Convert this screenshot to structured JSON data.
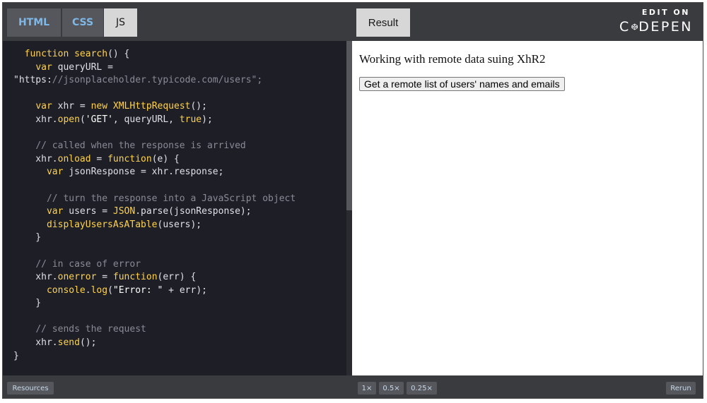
{
  "editor": {
    "tabs": {
      "html": "HTML",
      "css": "CSS",
      "js": "JS"
    }
  },
  "result_panel": {
    "tab_label": "Result",
    "logo": {
      "top": "EDIT ON",
      "left_text": "C",
      "right_text": "DEPEN"
    },
    "heading": "Working with remote data suing XhR2",
    "button_label": "Get a remote list of users' names and emails"
  },
  "bottom": {
    "resources_label": "Resources",
    "zoom_options": [
      "1×",
      "0.5×",
      "0.25×"
    ],
    "rerun_label": "Rerun"
  },
  "code_lines": [
    "  function search() {",
    "    var queryURL =",
    "\"https://jsonplaceholder.typicode.com/users\";",
    "",
    "    var xhr = new XMLHttpRequest();",
    "    xhr.open('GET', queryURL, true);",
    "",
    "    // called when the response is arrived",
    "    xhr.onload = function(e) {",
    "      var jsonResponse = xhr.response;",
    "",
    "      // turn the response into a JavaScript object",
    "      var users = JSON.parse(jsonResponse);",
    "      displayUsersAsATable(users);",
    "    }",
    "",
    "    // in case of error",
    "    xhr.onerror = function(err) {",
    "      console.log(\"Error: \" + err);",
    "    }",
    "",
    "    // sends the request",
    "    xhr.send();",
    "}"
  ],
  "colors": {
    "editor_bg": "#1e1f26",
    "bar_bg": "#3a3b3f",
    "tab_inactive_text": "#7fb7e6",
    "keyword": "#ffd24d",
    "comment": "#888a96"
  },
  "icons": [
    "codepen-logo-icon"
  ]
}
